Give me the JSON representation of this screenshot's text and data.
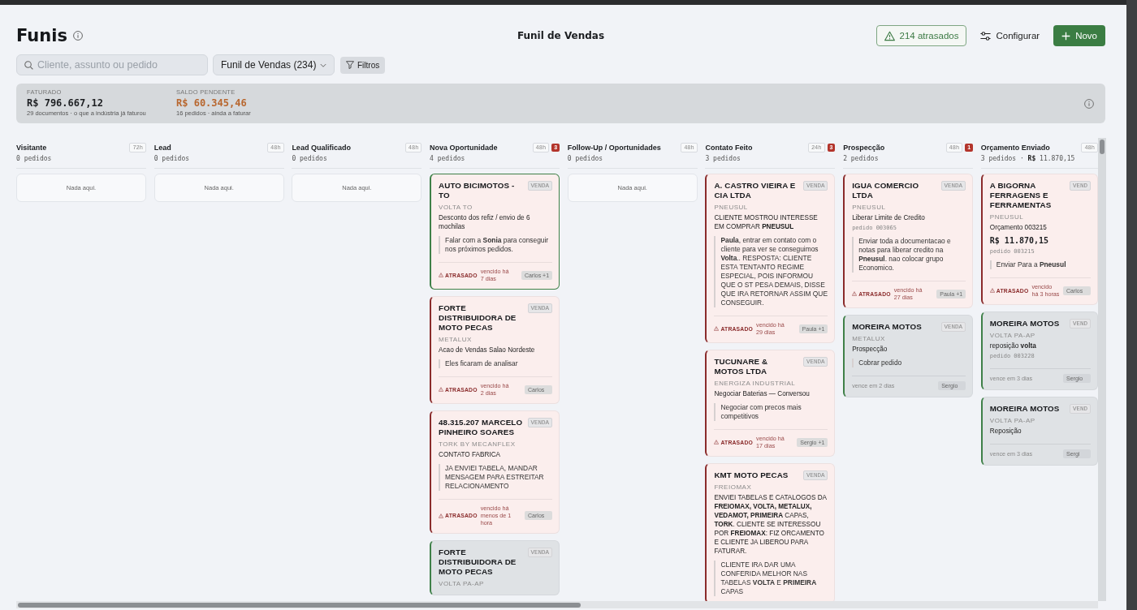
{
  "header": {
    "title": "Funis",
    "board_title": "Funil de Vendas",
    "overdue_button": "214 atrasados",
    "configure_button": "Configurar",
    "new_button": "Novo"
  },
  "toolbar": {
    "search": {
      "placeholder": "Cliente, assunto ou pedido"
    },
    "funnel_select": "Funil de Vendas (234)",
    "filter_button": "Filtros"
  },
  "summary": {
    "metrics": [
      {
        "label": "FATURADO",
        "value": "R$ 796.667,12",
        "caption": "29 documentos · o que a indústria já faturou",
        "kind": "neutral"
      },
      {
        "label": "SALDO PENDENTE",
        "value": "R$ 60.345,46",
        "caption": "16 pedidos · ainda a faturar",
        "kind": "pending"
      }
    ]
  },
  "columns": [
    {
      "title": "Visitante",
      "sla": "72h",
      "count_text": "0 pedidos",
      "empty_text": "Nada aqui."
    },
    {
      "title": "Lead",
      "sla": "48h",
      "count_text": "0 pedidos",
      "empty_text": "Nada aqui."
    },
    {
      "title": "Lead Qualificado",
      "sla": "48h",
      "count_text": "0 pedidos",
      "empty_text": "Nada aqui."
    },
    {
      "title": "Nova Oportunidade",
      "sla": "48h",
      "overdue_count": "3",
      "count_text": "4 pedidos",
      "cards": [
        {
          "client": "AUTO BICIMOTOS - TO",
          "tag": "VENDA",
          "brand": "VOLTA TO",
          "subject": "Desconto dos refiz / envio de 6 mochilas",
          "note": "Falar com a **Sonia** para conseguir nos próximos pedidos.",
          "overdue": true,
          "selected": true,
          "status": "ATRASADO",
          "due": "vencido há 7 dias",
          "assignee": "Carlos +1"
        },
        {
          "client": "FORTE DISTRIBUIDORA DE MOTO PECAS",
          "tag": "VENDA",
          "brand": "METALUX",
          "subject": "Acao de Vendas Salao Nordeste",
          "note": "Eles ficaram de analisar",
          "overdue": true,
          "selected": false,
          "status": "ATRASADO",
          "due": "vencido há 2 dias",
          "assignee": "Carlos"
        },
        {
          "client": "48.315.207 MARCELO PINHEIRO SOARES",
          "tag": "VENDA",
          "brand": "TORK BY MECANFLEX",
          "subject": "CONTATO FABRICA",
          "note": "JA ENVIEI TABELA, MANDAR MENSAGEM PARA ESTREITAR RELACIONAMENTO",
          "overdue": true,
          "selected": false,
          "status": "ATRASADO",
          "due": "vencido há menos de 1 hora",
          "assignee": "Carlos"
        },
        {
          "client": "FORTE DISTRIBUIDORA DE MOTO PECAS",
          "tag": "VENDA",
          "brand": "VOLTA PA-AP",
          "overdue": false,
          "selected": false
        }
      ]
    },
    {
      "title": "Follow-Up / Oportunidades",
      "sla": "48h",
      "count_text": "0 pedidos",
      "empty_text": "Nada aqui."
    },
    {
      "title": "Contato Feito",
      "sla": "24h",
      "overdue_count": "3",
      "count_text": "3 pedidos",
      "cards": [
        {
          "client": "A. CASTRO VIEIRA E CIA LTDA",
          "tag": "VENDA",
          "brand": "PNEUSUL",
          "subject": "CLIENTE MOSTROU INTERESSE EM COMPRAR **PNEUSUL**",
          "note": "**Paula**, entrar em contato com o cliente para ver se conseguimos **Volta**.. RESPOSTA: CLIENTE ESTA TENTANTO REGIME ESPECIAL, POIS INFORMOU QUE O ST PESA DEMAIS, DISSE QUE IRA RETORNAR ASSIM QUE CONSEGUIR.",
          "overdue": true,
          "selected": false,
          "status": "ATRASADO",
          "due": "vencido há 29 dias",
          "assignee": "Paula +1"
        },
        {
          "client": "TUCUNARE & MOTOS LTDA",
          "tag": "VENDA",
          "brand": "ENERGIZA INDUSTRIAL",
          "subject": "Negociar Baterias — Conversou",
          "note": "Negociar com precos mais competitivos",
          "overdue": true,
          "selected": false,
          "status": "ATRASADO",
          "due": "vencido há 17 dias",
          "assignee": "Sergio +1"
        },
        {
          "client": "KMT MOTO PECAS",
          "tag": "VENDA",
          "brand": "FREIOMAX",
          "subject": "ENVIEI TABELAS E CATALOGOS DA **FREIOMAX, VOLTA, METALUX, VEDAMOT, PRIMEIRA** CAPAS, **TORK**. CLIENTE SE INTERESSOU POR **FREIOMAX**: FIZ ORCAMENTO E CLIENTE JA LIBEROU PARA FATURAR.",
          "note": "CLIENTE IRA DAR UMA CONFERIDA MELHOR NAS TABELAS **VOLTA** E **PRIMEIRA** CAPAS",
          "overdue": true,
          "selected": false
        }
      ]
    },
    {
      "title": "Prospecção",
      "sla": "48h",
      "overdue_count": "1",
      "count_text": "2 pedidos",
      "cards": [
        {
          "client": "IGUA COMERCIO LTDA",
          "tag": "VENDA",
          "brand": "PNEUSUL",
          "subject": "Liberar Limite de Credito",
          "order": "pedido 003065",
          "note": "Enviar toda a documentacao e notas para liberar credito na **Pneusul**. nao colocar grupo Economico.",
          "overdue": true,
          "selected": false,
          "status": "ATRASADO",
          "due": "vencido há 27 dias",
          "assignee": "Paula +1"
        },
        {
          "client": "MOREIRA MOTOS",
          "tag": "VENDA",
          "brand": "METALUX",
          "subject": "Prospecção",
          "note": "Cobrar pedido",
          "overdue": false,
          "selected": false,
          "due": "vence em 2 dias",
          "assignee": "Sergio"
        }
      ]
    },
    {
      "title": "Orçamento Enviado",
      "sla": "48h",
      "count_text": "3 pedidos · **R$** 11.870,15",
      "cards": [
        {
          "client": "A BIGORNA FERRAGENS E FERRAMENTAS",
          "tag": "VEND",
          "brand": "PNEUSUL",
          "subject": "Orçamento 003215",
          "amount": "R$ 11.870,15",
          "order": "pedido 003215",
          "note": "Enviar Para a **Pneusul**",
          "overdue": true,
          "selected": false,
          "status": "ATRASADO",
          "due": "vencido há 3 horas",
          "assignee": "Carlos"
        },
        {
          "client": "MOREIRA MOTOS",
          "tag": "VEND",
          "brand": "VOLTA PA-AP",
          "subject": "reposição **volta**",
          "order": "pedido 003228",
          "overdue": false,
          "selected": false,
          "due": "vence em 3 dias",
          "assignee": "Sergio"
        },
        {
          "client": "MOREIRA MOTOS",
          "tag": "VEND",
          "brand": "VOLTA PA-AP",
          "subject": "Reposição",
          "overdue": false,
          "selected": false,
          "due": "vence em 3 dias",
          "assignee": "Sergi"
        }
      ]
    }
  ]
}
